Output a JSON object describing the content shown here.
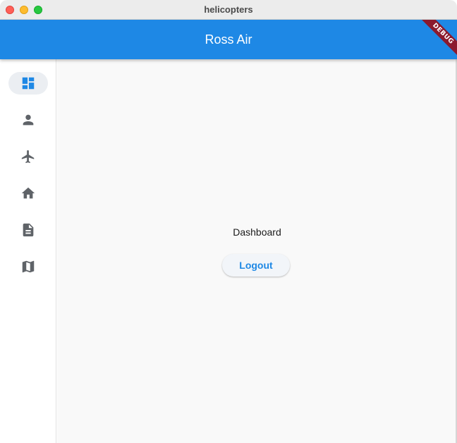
{
  "window": {
    "title": "helicopters"
  },
  "appbar": {
    "title": "Ross Air",
    "debug_banner": "DEBUG"
  },
  "rail": {
    "items": [
      {
        "icon": "dashboard-icon",
        "selected": true
      },
      {
        "icon": "person-icon",
        "selected": false
      },
      {
        "icon": "airplane-icon",
        "selected": false
      },
      {
        "icon": "home-icon",
        "selected": false
      },
      {
        "icon": "document-icon",
        "selected": false
      },
      {
        "icon": "map-icon",
        "selected": false
      }
    ]
  },
  "main": {
    "page_label": "Dashboard",
    "logout_label": "Logout"
  },
  "colors": {
    "primary": "#1e88e5",
    "icon": "#5f6368",
    "debug": "#8b1a2e"
  }
}
